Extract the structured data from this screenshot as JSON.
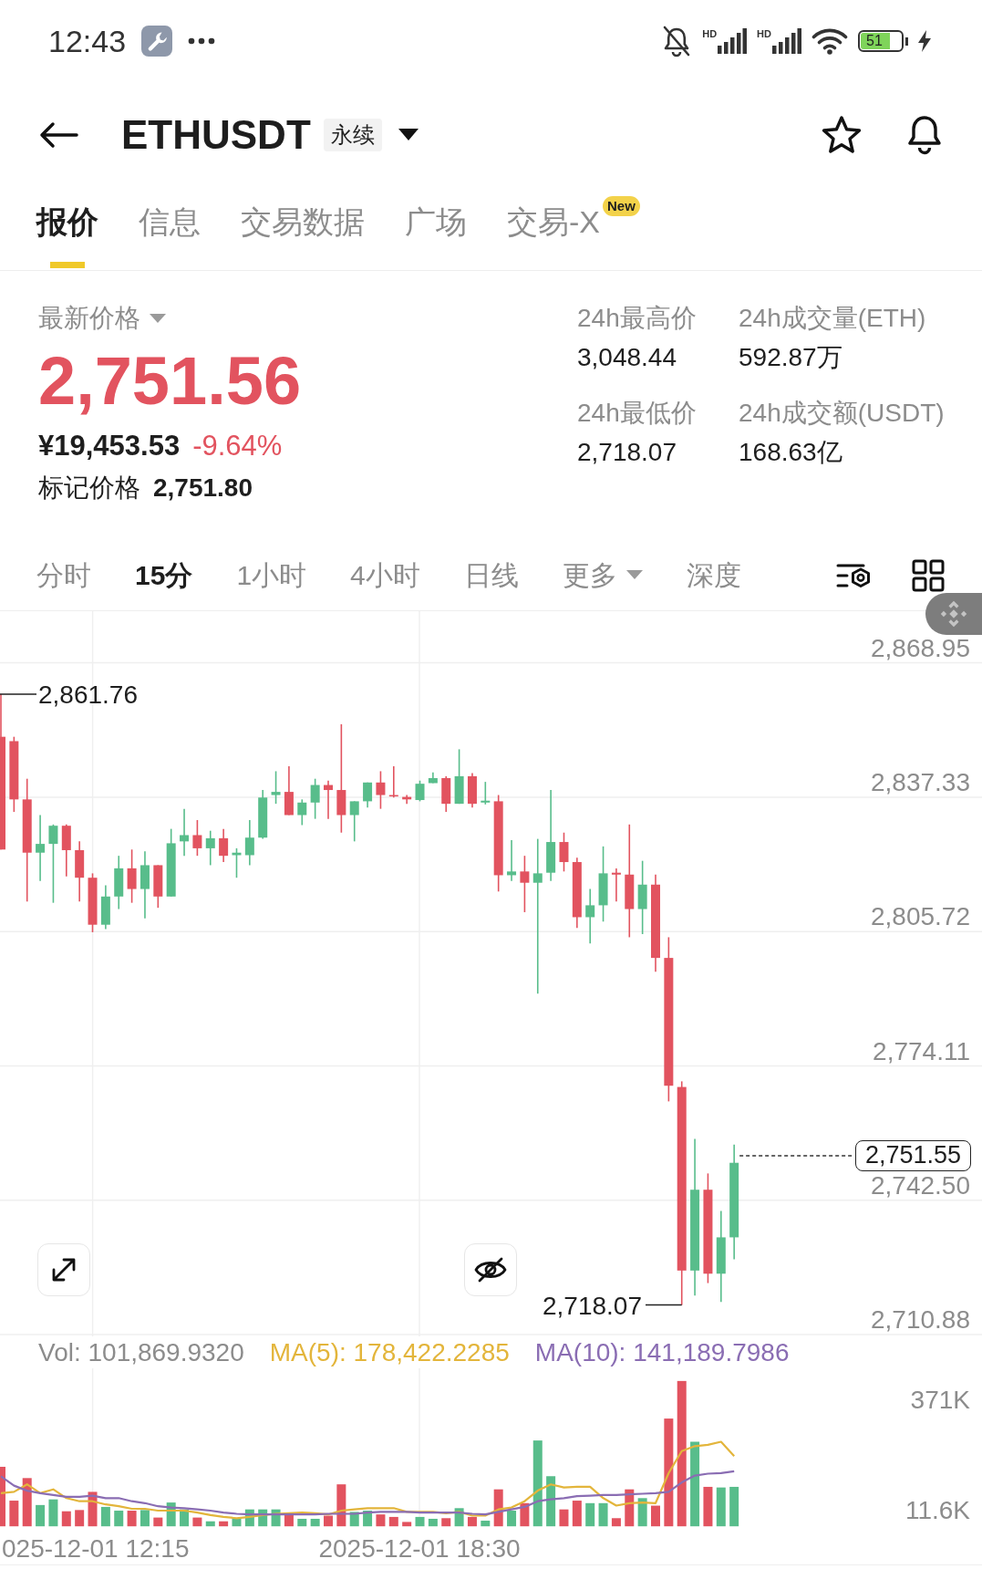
{
  "status_bar": {
    "time": "12:43",
    "network_labels": [
      "HD",
      "HD"
    ],
    "battery": "51"
  },
  "header": {
    "symbol": "ETHUSDT",
    "badge": "永续"
  },
  "tabs": [
    {
      "label": "报价",
      "selected": true
    },
    {
      "label": "信息",
      "selected": false
    },
    {
      "label": "交易数据",
      "selected": false
    },
    {
      "label": "广场",
      "selected": false
    },
    {
      "label": "交易-X",
      "selected": false,
      "badge": "New"
    }
  ],
  "price": {
    "label": "最新价格",
    "last": "2,751.56",
    "cny": "¥19,453.53",
    "change": "-9.64%",
    "mark_label": "标记价格",
    "mark_value": "2,751.80"
  },
  "stats": [
    {
      "label": "24h最高价",
      "value": "3,048.44"
    },
    {
      "label": "24h成交量(ETH)",
      "value": "592.87万"
    },
    {
      "label": "24h最低价",
      "value": "2,718.07"
    },
    {
      "label": "24h成交额(USDT)",
      "value": "168.63亿"
    }
  ],
  "intervals": [
    {
      "label": "分时",
      "selected": false,
      "dropdown": false
    },
    {
      "label": "15分",
      "selected": true,
      "dropdown": false
    },
    {
      "label": "1小时",
      "selected": false,
      "dropdown": false
    },
    {
      "label": "4小时",
      "selected": false,
      "dropdown": false
    },
    {
      "label": "日线",
      "selected": false,
      "dropdown": false
    },
    {
      "label": "更多",
      "selected": false,
      "dropdown": true
    },
    {
      "label": "深度",
      "selected": false,
      "dropdown": false
    }
  ],
  "chart": {
    "price_ticks": [
      "2,868.95",
      "2,837.33",
      "2,805.72",
      "2,774.11",
      "2,742.50",
      "2,710.88"
    ],
    "high_marker": "2,861.76",
    "low_marker": "2,718.07",
    "last_price_tag": "2,751.55"
  },
  "volume": {
    "legend": [
      {
        "label": "Vol: 101,869.9320",
        "color": "#8c8c8c"
      },
      {
        "label": "MA(5): 178,422.2285",
        "color": "#e3b53b"
      },
      {
        "label": "MA(10): 141,189.7986",
        "color": "#8a6db3"
      }
    ],
    "ticks": [
      "371K",
      "11.6K"
    ]
  },
  "time_axis": [
    "025-12-01 12:15",
    "2025-12-01 18:30"
  ]
}
